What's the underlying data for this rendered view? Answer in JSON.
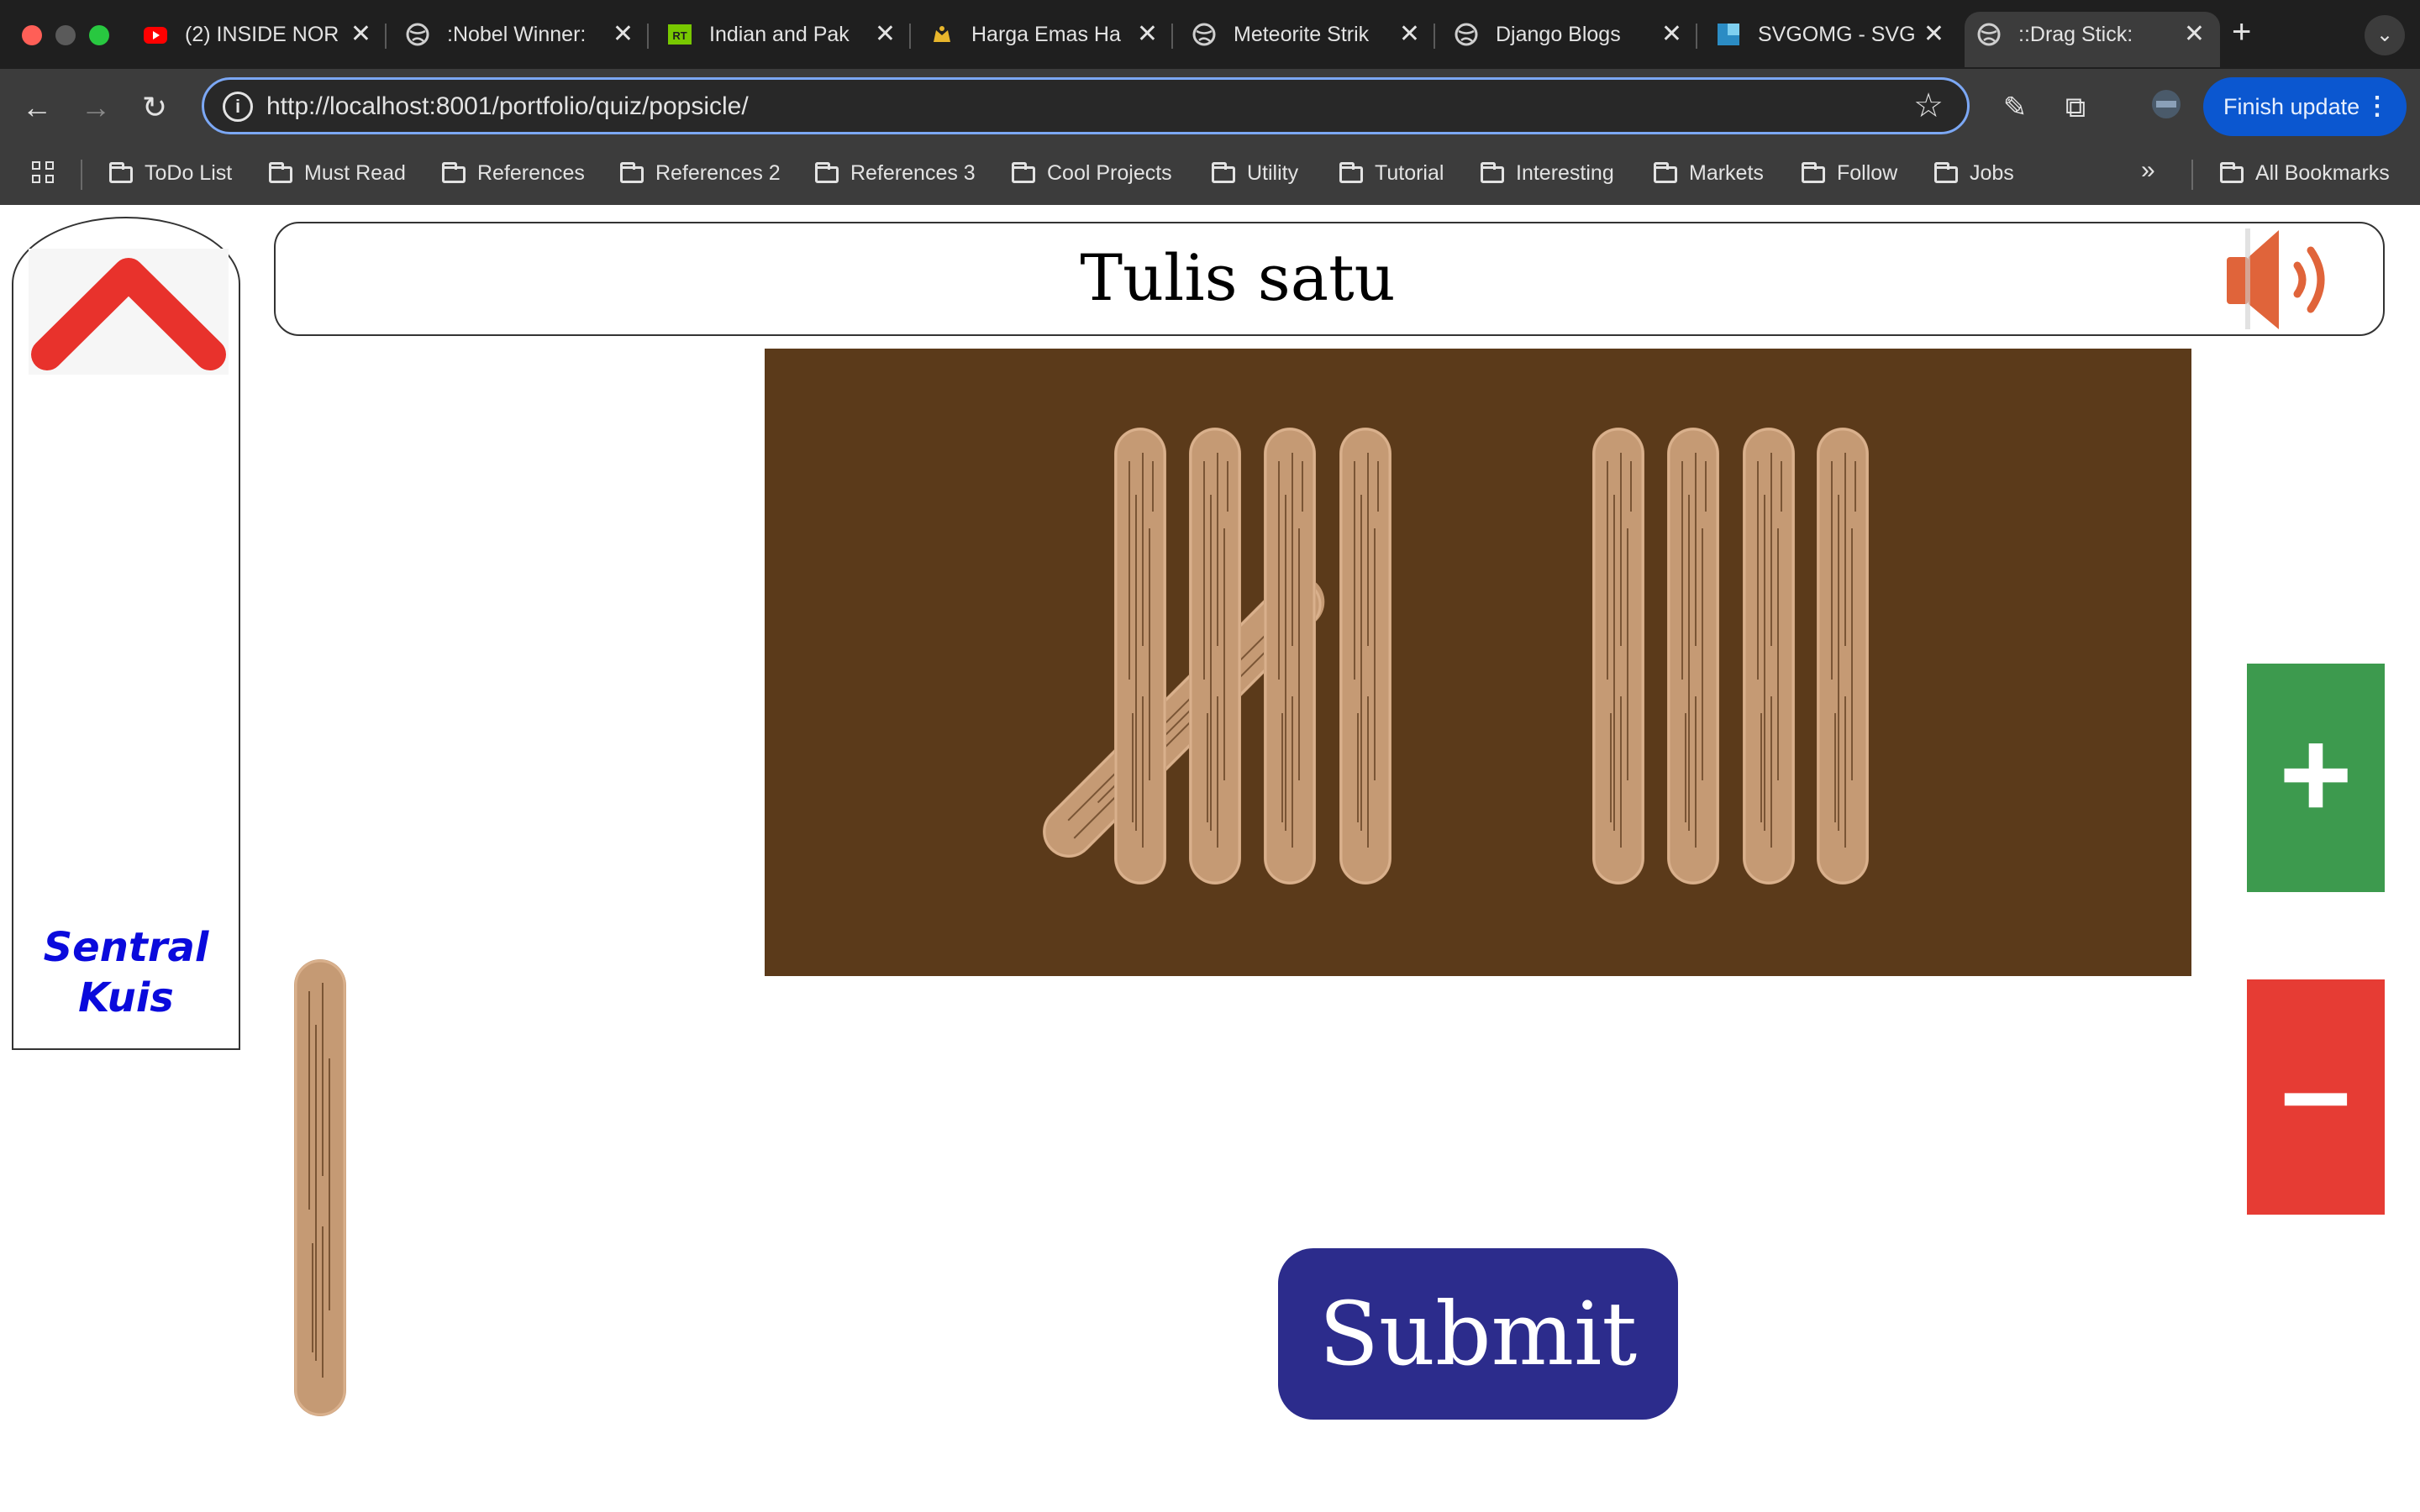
{
  "browser": {
    "tabs": [
      {
        "title": "(2) INSIDE NOR",
        "favicon": "youtube-icon"
      },
      {
        "title": ":Nobel Winner:",
        "favicon": "globe-icon"
      },
      {
        "title": "Indian and Pak",
        "favicon": "rt-icon"
      },
      {
        "title": "Harga Emas Ha",
        "favicon": "gold-icon"
      },
      {
        "title": "Meteorite Strik",
        "favicon": "globe-icon"
      },
      {
        "title": "Django Blogs",
        "favicon": "globe-icon"
      },
      {
        "title": "SVGOMG - SVG",
        "favicon": "svgomg-icon"
      },
      {
        "title": "::Drag Stick:",
        "favicon": "globe-icon",
        "active": true
      }
    ],
    "url": "http://localhost:8001/portfolio/quiz/popsicle/",
    "finish_update_label": "Finish update",
    "bookmarks": [
      "ToDo List",
      "Must Read",
      "References",
      "References 2",
      "References 3",
      "Cool Projects",
      "Utility",
      "Tutorial",
      "Interesting",
      "Markets",
      "Follow",
      "Jobs"
    ],
    "all_bookmarks_label": "All Bookmarks",
    "overflow_label": "»",
    "accent": "#0b57d0"
  },
  "quiz": {
    "sidebar_label_line1": "Sentral",
    "sidebar_label_line2": "Kuis",
    "question": "Tulis satu",
    "submit_label": "Submit",
    "plus_label": "+",
    "minus_label": "–",
    "board_sticks_count": 9,
    "colors": {
      "board": "#5b3a1a",
      "stick": "#c59a74",
      "plus": "#3d9a4e",
      "minus": "#e63c34",
      "submit": "#2c2c8c",
      "arrow": "#e8322c",
      "speaker": "#e0643a"
    }
  }
}
